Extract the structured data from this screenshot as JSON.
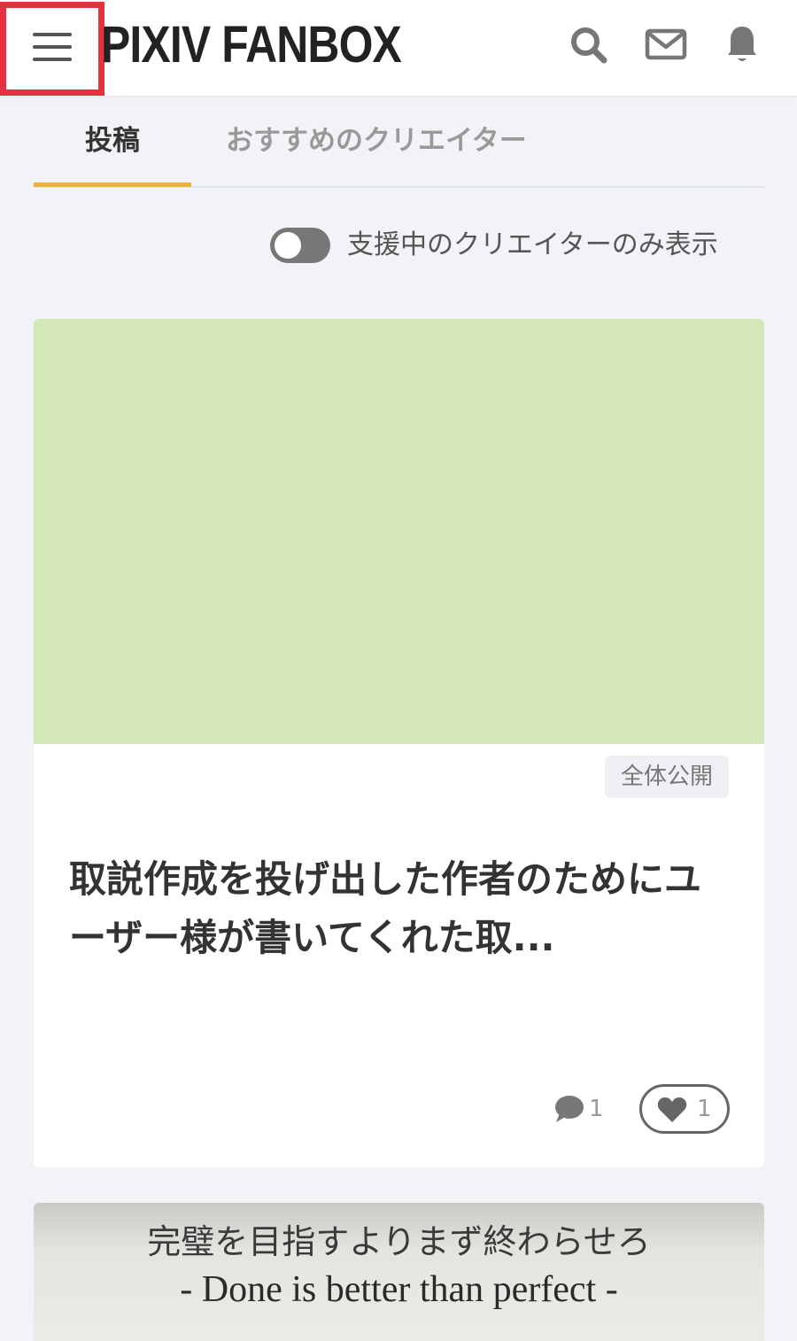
{
  "header": {
    "logo": "PIXIV FANBOX",
    "icons": [
      "search-icon",
      "mail-icon",
      "bell-icon"
    ]
  },
  "tabs": [
    {
      "label": "投稿",
      "active": true
    },
    {
      "label": "おすすめのクリエイター",
      "active": false
    }
  ],
  "filter": {
    "label": "支援中のクリエイターのみ表示",
    "enabled": false
  },
  "post": {
    "image_color": "#d3e7b9",
    "badge": "全体公開",
    "title": "取説作成を投げ出した作者のためにユーザー様が書いてくれた取...",
    "comment_count": "1",
    "like_count": "1"
  },
  "next_post": {
    "image_text_jp": "完璧を目指すよりまず終わらせろ",
    "image_text_en": "- Done is better than perfect -"
  },
  "colors": {
    "accent": "#ecb53a",
    "highlight_box": "#e5323e",
    "background": "#f2f3f7"
  }
}
